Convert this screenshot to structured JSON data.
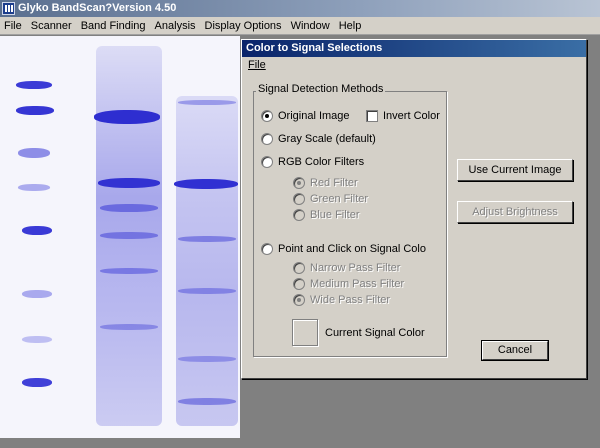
{
  "app": {
    "title": "Glyko BandScan?Version 4.50"
  },
  "menubar": [
    "File",
    "Scanner",
    "Band Finding",
    "Analysis",
    "Display Options",
    "Window",
    "Help"
  ],
  "dialog": {
    "title": "Color to Signal Selections",
    "menu_file": "File",
    "group_label": "Signal Detection Methods",
    "original_image": "Original Image",
    "invert_color": "Invert Color",
    "gray_scale": "Gray Scale (default)",
    "rgb_filters": "RGB Color Filters",
    "red_filter": "Red Filter",
    "green_filter": "Green Filter",
    "blue_filter": "Blue Filter",
    "point_click": "Point and Click on Signal Colo",
    "narrow_filter": "Narrow Pass Filter",
    "medium_filter": "Medium Pass Filter",
    "wide_filter": "Wide Pass Filter",
    "current_signal_color": "Current Signal Color",
    "use_current_image": "Use Current Image",
    "adjust_brightness": "Adjust Brightness",
    "cancel": "Cancel"
  },
  "state": {
    "selected_method": "original_image",
    "invert_color_checked": false,
    "rgb_selected": "red",
    "pass_selected": "wide",
    "current_signal_color_hex": "#d4d0c8"
  },
  "colors": {
    "band": "#3a3ad8",
    "gel_background": "#f5f5fc",
    "dialog_title": "#0a246a"
  }
}
